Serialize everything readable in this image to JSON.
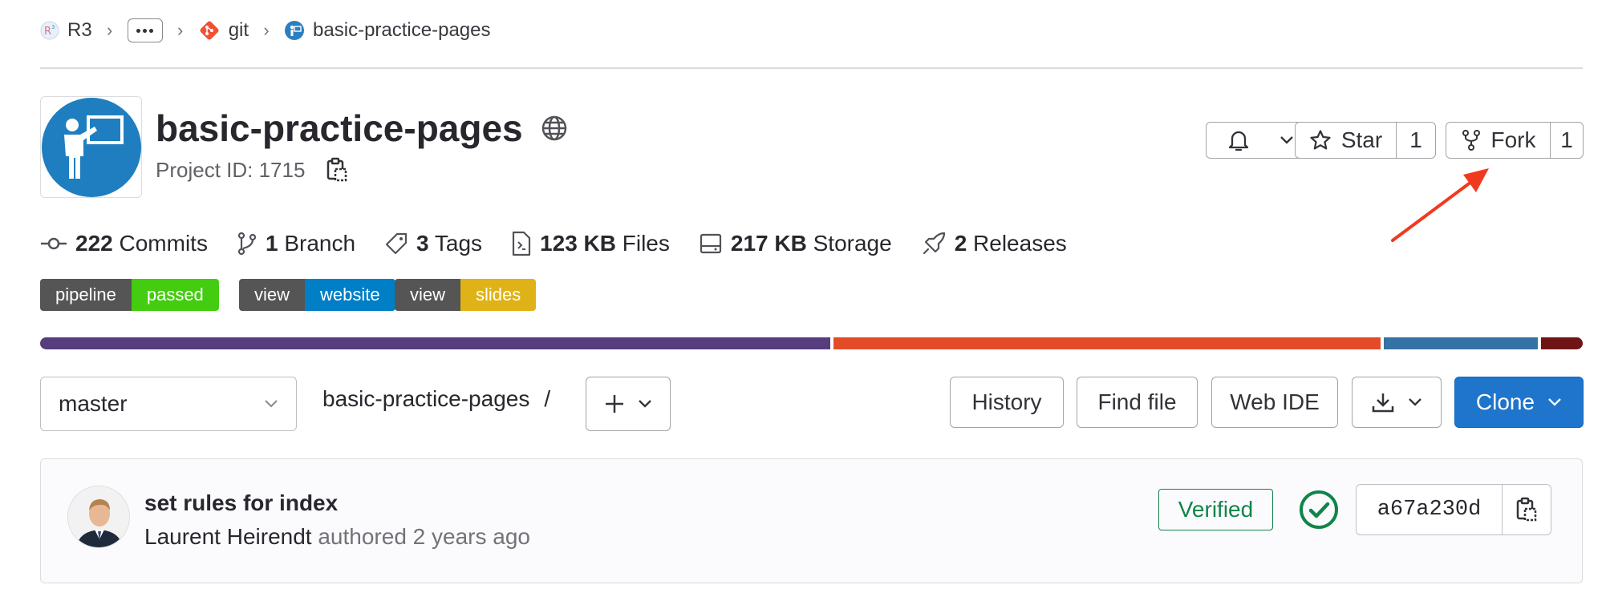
{
  "breadcrumb": {
    "items": [
      {
        "label": "R3",
        "icon": "r3-group-avatar"
      },
      {
        "label": "git",
        "icon": "git-logo"
      },
      {
        "label": "basic-practice-pages",
        "icon": "project-avatar"
      }
    ]
  },
  "project": {
    "name": "basic-practice-pages",
    "visibility_icon": "globe-icon",
    "id_text": "Project ID: 1715"
  },
  "actions": {
    "notification_icon": "bell-icon",
    "star_label": "Star",
    "star_count": "1",
    "fork_label": "Fork",
    "fork_count": "1"
  },
  "stats": [
    {
      "icon": "commit-icon",
      "value": "222",
      "label": "Commits"
    },
    {
      "icon": "branch-icon",
      "value": "1",
      "label": "Branch"
    },
    {
      "icon": "tag-icon",
      "value": "3",
      "label": "Tags"
    },
    {
      "icon": "file-icon",
      "value": "123 KB",
      "label": "Files"
    },
    {
      "icon": "storage-icon",
      "value": "217 KB",
      "label": "Storage"
    },
    {
      "icon": "rocket-icon",
      "value": "2",
      "label": "Releases"
    }
  ],
  "badges": [
    {
      "left": "pipeline",
      "right": "passed",
      "color": "#4c1"
    },
    {
      "left": "view",
      "right": "website",
      "color": "#007ec6"
    },
    {
      "left": "view",
      "right": "slides",
      "color": "#dfb317"
    }
  ],
  "language_bar": [
    {
      "fraction": 0.513,
      "color": "#563d7c"
    },
    {
      "fraction": 0.355,
      "color": "#e34c26"
    },
    {
      "fraction": 0.1,
      "color": "#3572a5"
    },
    {
      "fraction": 0.027,
      "color": "#701516"
    }
  ],
  "toolbar": {
    "branch": "master",
    "path": "basic-practice-pages",
    "path_sep": "/",
    "history": "History",
    "find_file": "Find file",
    "web_ide": "Web IDE",
    "clone": "Clone"
  },
  "commit": {
    "title": "set rules for index",
    "author": "Laurent Heirendt",
    "meta": "authored 2 years ago",
    "verified": "Verified",
    "sha": "a67a230d"
  },
  "colors": {
    "primary": "#1f75cb",
    "success": "#108548",
    "annotation_arrow": "#f03a1f"
  }
}
